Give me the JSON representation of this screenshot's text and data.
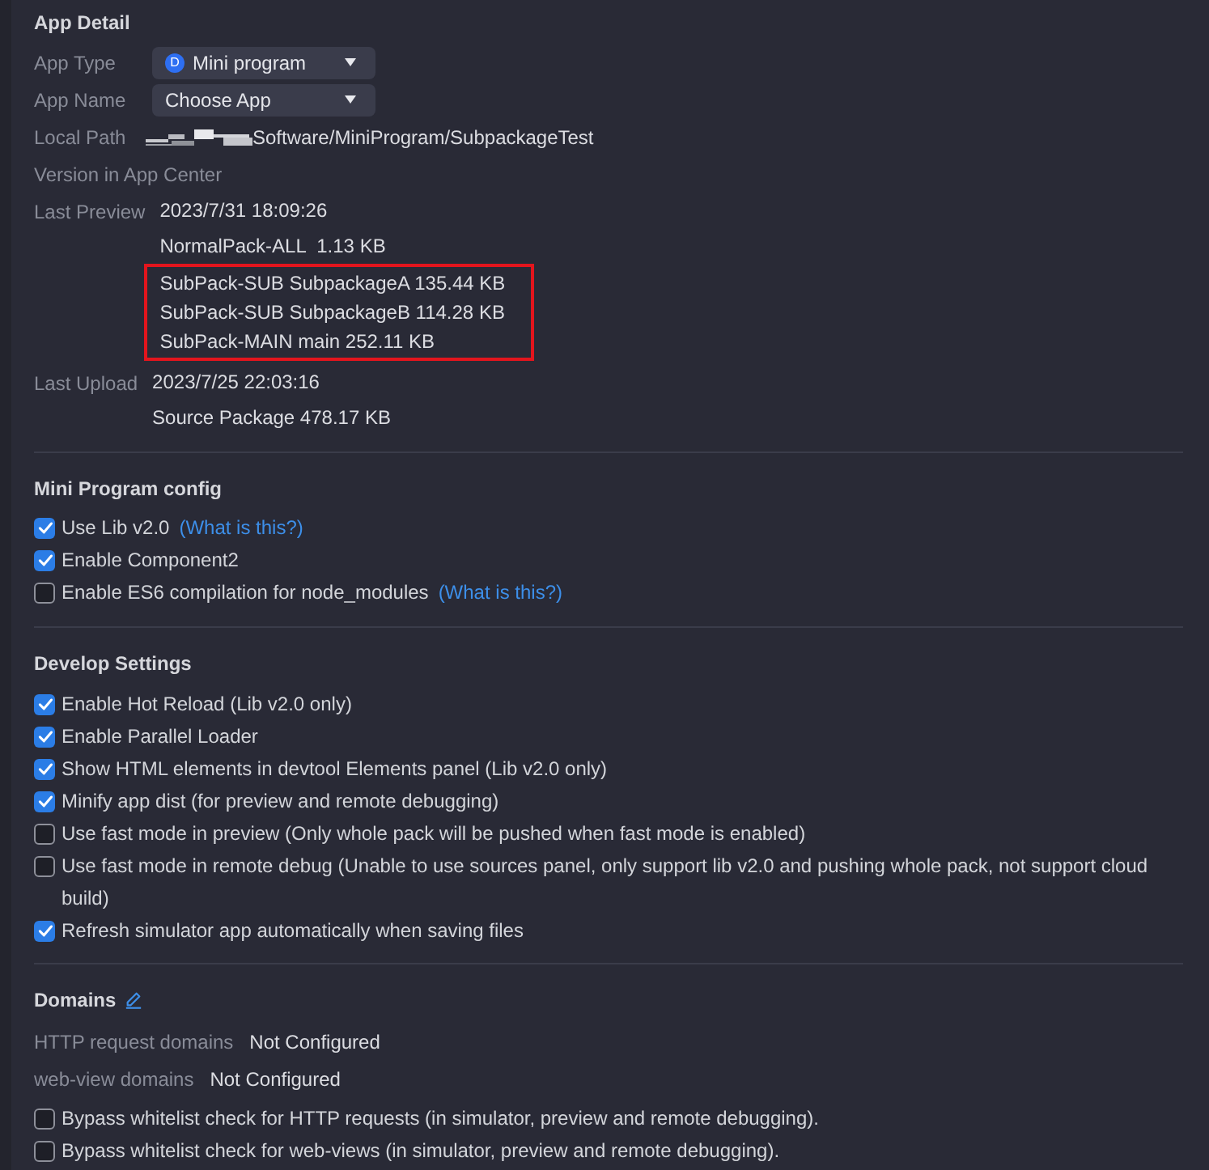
{
  "app_detail": {
    "title": "App Detail",
    "fields": [
      {
        "kind": "dropdown",
        "label": "App Type",
        "value": "Mini program",
        "badge": "D"
      },
      {
        "kind": "dropdown",
        "label": "App Name",
        "value": "Choose App"
      },
      {
        "kind": "path",
        "label": "Local Path",
        "value": "Software/MiniProgram/SubpackageTest",
        "redacted": true
      },
      {
        "kind": "plain",
        "label": "Version in App Center"
      },
      {
        "kind": "lines",
        "label": "Last Preview",
        "lines": [
          {
            "text": "2023/7/31 18:09:26",
            "highlighted": false
          },
          {
            "text": "NormalPack-ALL  1.13 KB",
            "highlighted": false
          },
          {
            "text": "SubPack-SUB SubpackageA 135.44 KB",
            "highlighted": true
          },
          {
            "text": "SubPack-SUB SubpackageB 114.28 KB",
            "highlighted": true
          },
          {
            "text": "SubPack-MAIN main 252.11 KB",
            "highlighted": true
          }
        ]
      },
      {
        "kind": "lines",
        "label": "Last Upload",
        "lines": [
          {
            "text": "2023/7/25 22:03:16",
            "highlighted": false
          },
          {
            "text": "Source Package 478.17 KB",
            "highlighted": false
          }
        ]
      }
    ]
  },
  "mini_program_config": {
    "title": "Mini Program config",
    "options": [
      {
        "label": "Use Lib v2.0",
        "checked": true,
        "link": "(What is this?)"
      },
      {
        "label": "Enable Component2",
        "checked": true
      },
      {
        "label": "Enable ES6 compilation for node_modules",
        "checked": false,
        "link": "(What is this?)"
      }
    ]
  },
  "develop_settings": {
    "title": "Develop Settings",
    "options": [
      {
        "label": "Enable Hot Reload (Lib v2.0 only)",
        "checked": true
      },
      {
        "label": "Enable Parallel Loader",
        "checked": true
      },
      {
        "label": "Show HTML elements in devtool Elements panel (Lib v2.0 only)",
        "checked": true
      },
      {
        "label": "Minify app dist (for preview and remote debugging)",
        "checked": true
      },
      {
        "label": "Use fast mode in preview (Only whole pack will be pushed when fast mode is enabled)",
        "checked": false
      },
      {
        "label": "Use fast mode in remote debug (Unable to use sources panel, only support lib v2.0 and pushing whole pack, not support cloud build)",
        "checked": false
      },
      {
        "label": "Refresh simulator app automatically when saving files",
        "checked": true
      }
    ]
  },
  "domains": {
    "title": "Domains",
    "editable": true,
    "rows": [
      {
        "label": "HTTP request domains",
        "value": "Not Configured"
      },
      {
        "label": "web-view domains",
        "value": "Not Configured"
      }
    ],
    "options": [
      {
        "label": "Bypass whitelist check for HTTP requests (in simulator, preview and remote debugging).",
        "checked": false
      },
      {
        "label": "Bypass whitelist check for web-views (in simulator, preview and remote debugging).",
        "checked": false
      }
    ]
  }
}
